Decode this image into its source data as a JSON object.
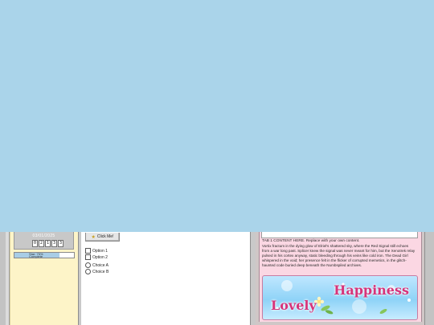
{
  "sidebar": {
    "date": "03/01/2025",
    "counter_digits": [
      "0",
      "2",
      "1",
      "3",
      "3"
    ],
    "progress_label": "Star: 75% Complete",
    "progress_value": 0.75
  },
  "center": {
    "button_label": "Click Me!",
    "checkboxes": [
      "Option 1",
      "Option 2"
    ],
    "radios": [
      "Choice A",
      "Choice B"
    ]
  },
  "tab": {
    "heading": "TAB 1 CONTENT HERE. Replace with your own content.",
    "body": "Vortix fractum in the dying glow of Elriel's shattered sky, where the Red Signal still echoes from a war long past. Splicer knew the signal was never meant for him, but the Xenotrek relay pulsed in his cortex anyway, static bleeding through his veins like cold iron. The Dead Girl whispered in the void; her presence felt in the flicker of corrupted memetics, in the glitch-haunted code buried deep beneath the Numbspiled archives."
  },
  "banner": {
    "word_1": "Happiness",
    "word_2": "Lovely"
  },
  "colors": {
    "sky": "#aad4ea",
    "sidebar": "#fdf4c8",
    "pink_panel": "#fbd7e3",
    "banner_text": "#d6347a"
  }
}
